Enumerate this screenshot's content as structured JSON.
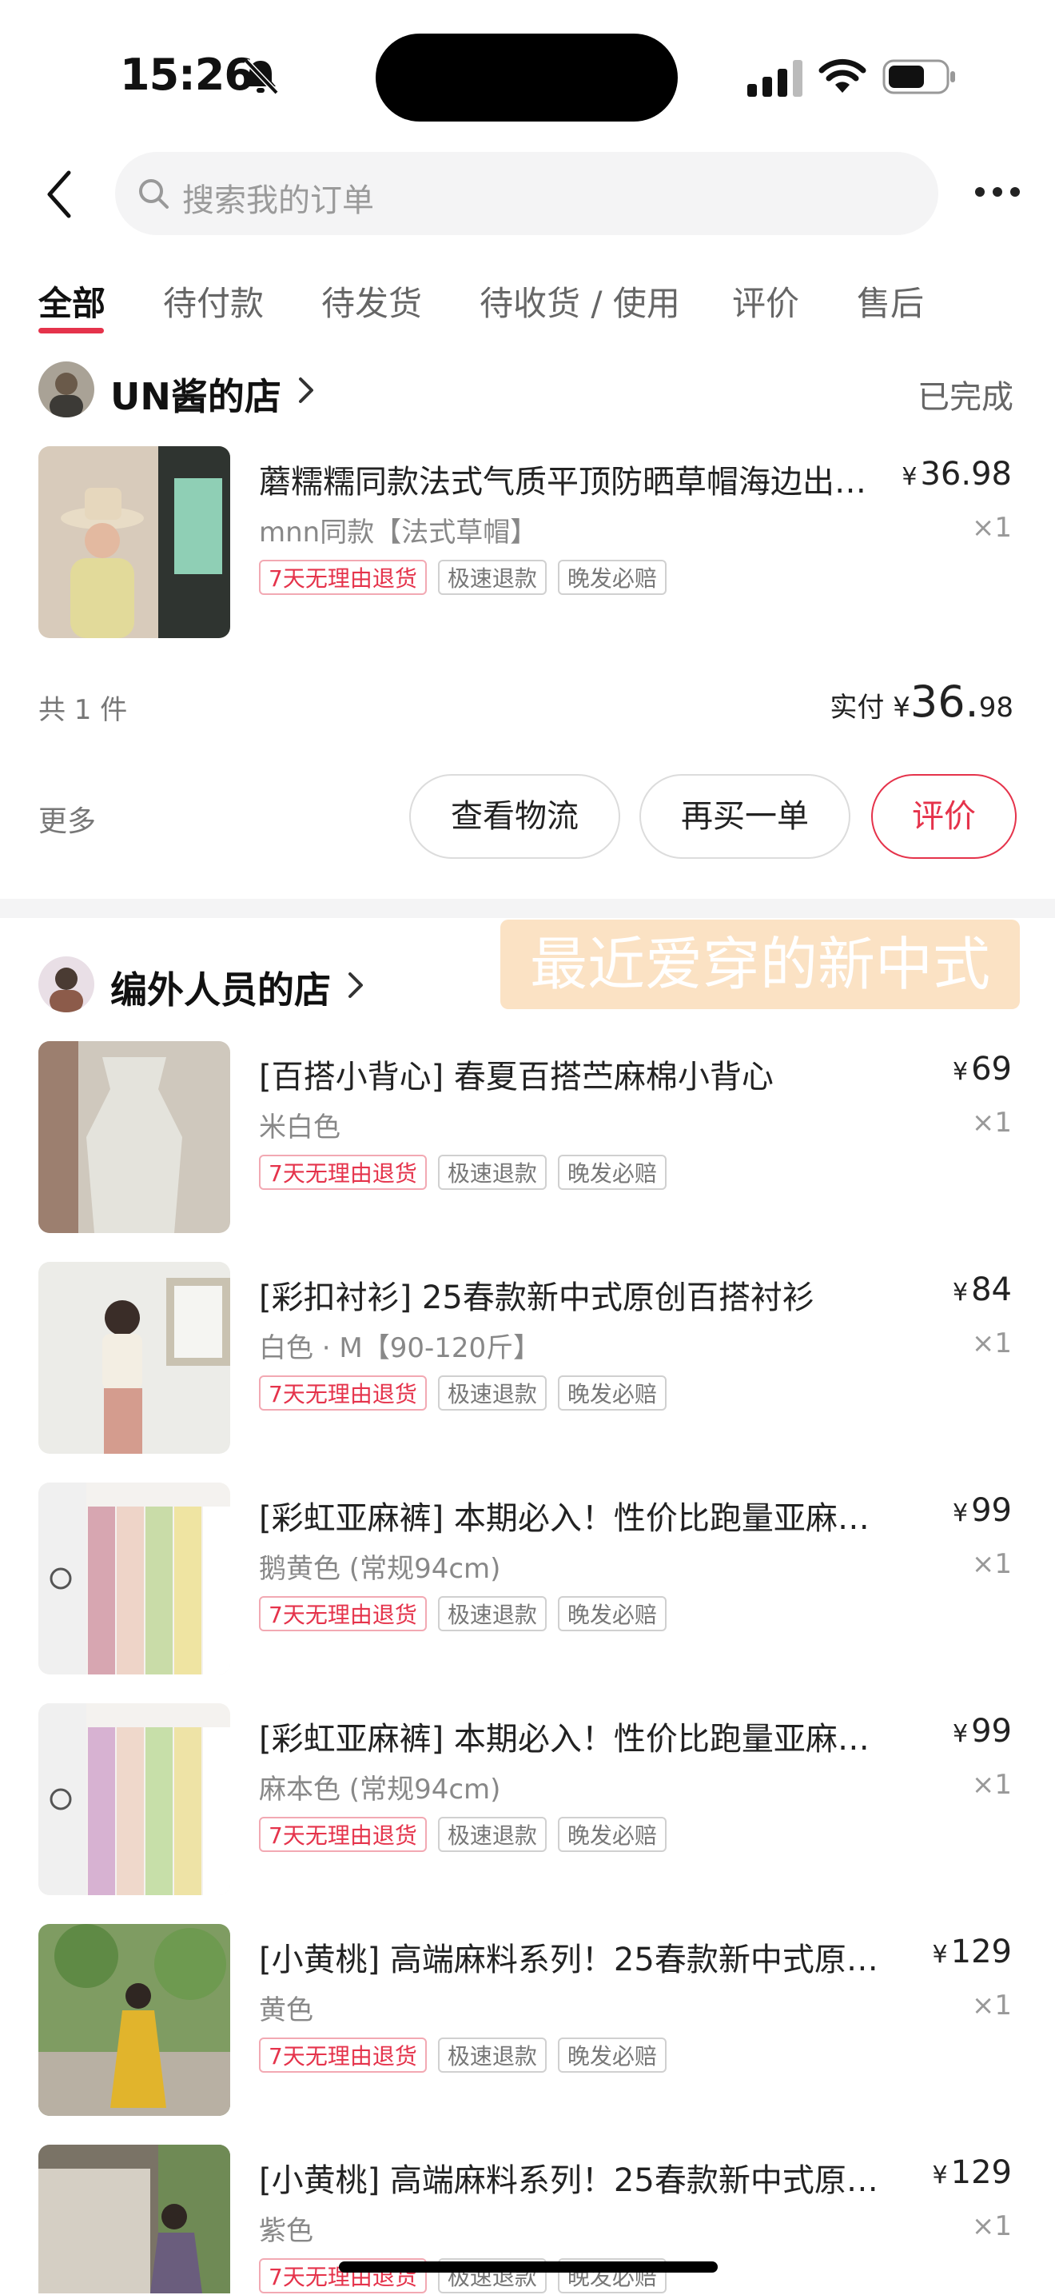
{
  "status_bar": {
    "time": "15:26"
  },
  "search": {
    "placeholder": "搜索我的订单"
  },
  "tabs": [
    {
      "label": "全部",
      "active": true
    },
    {
      "label": "待付款"
    },
    {
      "label": "待发货"
    },
    {
      "label": "待收货 / 使用"
    },
    {
      "label": "评价"
    },
    {
      "label": "售后"
    }
  ],
  "order1": {
    "shop_name": "UN酱的店",
    "status": "已完成",
    "item": {
      "title": "蘑糯糯同款法式气质平顶防晒草帽海边出…",
      "spec": "mnn同款【法式草帽】",
      "price_symbol": "¥",
      "price": "36.98",
      "qty": "×1",
      "tags": [
        "7天无理由退货",
        "极速退款",
        "晚发必赔"
      ]
    },
    "summary_count": "共 1 件",
    "summary_paid_label": "实付",
    "summary_yen": "¥",
    "summary_int": "36.",
    "summary_dec": "98",
    "more_label": "更多",
    "buttons": [
      "查看物流",
      "再买一单",
      "评价"
    ]
  },
  "order2": {
    "shop_name": "编外人员的店",
    "overlay_caption": "最近爱穿的新中式",
    "items": [
      {
        "title": "[百搭小背心] 春夏百搭苎麻棉小背心",
        "spec": "米白色",
        "price": "69",
        "qty": "×1"
      },
      {
        "title": "[彩扣衬衫] 25春款新中式原创百搭衬衫",
        "spec": "白色 · M【90-120斤】",
        "price": "84",
        "qty": "×1"
      },
      {
        "title": "[彩虹亚麻裤] 本期必入！性价比跑量亚麻…",
        "spec": "鹅黄色 (常规94cm)",
        "price": "99",
        "qty": "×1"
      },
      {
        "title": "[彩虹亚麻裤] 本期必入！性价比跑量亚麻…",
        "spec": "麻本色 (常规94cm)",
        "price": "99",
        "qty": "×1"
      },
      {
        "title": "[小黄桃] 高端麻料系列！25春款新中式原…",
        "spec": "黄色",
        "price": "129",
        "qty": "×1"
      },
      {
        "title": "[小黄桃] 高端麻料系列！25春款新中式原…",
        "spec": "紫色",
        "price": "129",
        "qty": "×1"
      }
    ],
    "price_symbol": "¥",
    "tags": [
      "7天无理由退货",
      "极速退款",
      "晚发必赔"
    ]
  },
  "colors": {
    "accent": "#e5334b",
    "divider": "#f4f4f5"
  }
}
